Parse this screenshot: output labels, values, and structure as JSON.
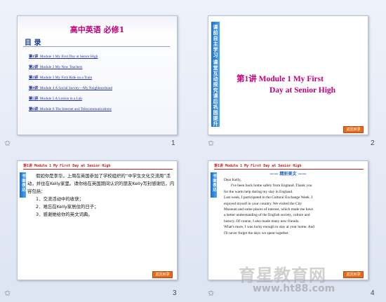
{
  "slides": [
    {
      "number": "1",
      "title": "高中英语 必修1",
      "menu_label": "目 录",
      "items": [
        {
          "lecture": "第1讲",
          "text": "Module 1   My First Day at Senior High"
        },
        {
          "lecture": "第2讲",
          "text": "Module 2   My New Teachers"
        },
        {
          "lecture": "第3讲",
          "text": "Module 3   My First Ride on a Train"
        },
        {
          "lecture": "第4讲",
          "text": "Module 4   A Social Survey—My Neighbourhood"
        },
        {
          "lecture": "第5讲",
          "text": "Module 5   A Lesson in a Lab"
        },
        {
          "lecture": "第6讲",
          "text": "Module 6   The Internet and Telecommunications"
        }
      ]
    },
    {
      "number": "2",
      "title_line1": "第1讲   Module 1   My First",
      "title_line2": "Day at Senior High",
      "side_tabs": [
        "课前自主学习",
        "课堂互动探究",
        "课后巩固提升"
      ],
      "button": "返回目录"
    },
    {
      "number": "3",
      "header": "第1讲  Module 1  My First Day at Senior High",
      "side_tab": "书面表达",
      "paragraph": "假如你是李华，上周在英国参加了学校组织的“中学生文化交流周”活动，并住在Kelly家里。请你给在英国期间认识的朋友Kelly写封感谢信，内容包括：",
      "list": [
        "1．交流活动中的收获；",
        "2．难忘在Kelly家居住的日子；",
        "3．感谢她给你的英文词典。"
      ],
      "button": "返回目录"
    },
    {
      "number": "4",
      "header": "第1讲  Module 1  My First Day at Senior High",
      "side_tab": "书面表达",
      "section_title": "—— 精彩美文 ——",
      "lines": [
        "Dear Kelly,",
        "I've been back home safely from England. Thank you",
        "for the warm help during my stay in England.",
        "Last week, I participated in the Cultural Exchange Week. I",
        "enjoyed myself in your country. We visited the City",
        "Museum and some places of interest, which made me have",
        "a better understanding of the English society, culture and",
        "history. Of course, I also made many new friends.",
        "What's more, I was lucky enough to stay at your home. And",
        "I'll never forget the days we spent together."
      ],
      "button": "返回目录"
    }
  ],
  "star_glyph": "✩",
  "watermark": {
    "main": "育星教育网",
    "url": "www.ht88.com"
  },
  "colors": {
    "title_magenta": "#c0007a",
    "link_blue": "#1f2fa0",
    "side_blue": "#1e6fd0",
    "button_orange": "#e8691a",
    "header_red": "#c02020"
  }
}
